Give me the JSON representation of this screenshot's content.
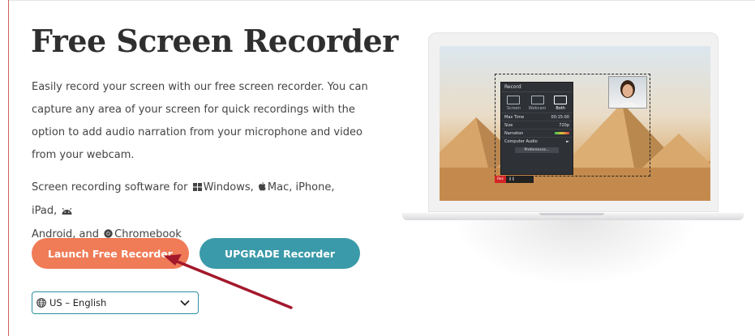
{
  "page": {
    "title": "Free Screen Recorder",
    "description": "Easily record your screen with our free screen recorder. You can capture any area of your screen for quick recordings with the option to add audio narration from your microphone and video from your webcam.",
    "platforms": {
      "prefix": "Screen recording software for",
      "windows": "Windows,",
      "mac": "Mac, iPhone, iPad,",
      "android": "Android, and",
      "chromebook": "Chromebook"
    }
  },
  "buttons": {
    "launch": "Launch Free Recorder",
    "upgrade": "UPGRADE Recorder"
  },
  "language": {
    "selected": "US – English"
  },
  "recorder_panel": {
    "title": "Record",
    "tabs": [
      "Screen",
      "Webcam",
      "Both"
    ],
    "rows": [
      {
        "label": "Max Time",
        "value": "00:15:00"
      },
      {
        "label": "Size",
        "value": "720p"
      },
      {
        "label": "Narration",
        "value": ""
      },
      {
        "label": "Computer Audio",
        "value": ""
      }
    ],
    "preferences": "Preferences...",
    "rec_button": "Rec"
  },
  "colors": {
    "launch": "#ef7b57",
    "upgrade": "#3b9aa9",
    "arrow": "#a3182b"
  }
}
